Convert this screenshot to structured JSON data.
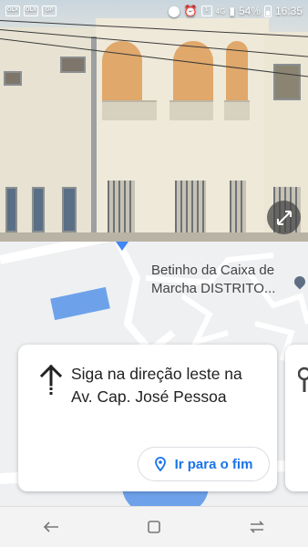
{
  "status_bar": {
    "notifications": [
      "OLX",
      "OLX",
      "GP"
    ],
    "network": "4G",
    "sim_badge": "1",
    "battery": "54%",
    "time": "16:35"
  },
  "street_view": {
    "expand_icon": "expand-arrows-icon"
  },
  "map": {
    "poi_label_line1": "Betinho da Caixa de",
    "poi_label_line2": "Marcha DISTRITO...",
    "water_color": "#6da2ea"
  },
  "direction_card": {
    "instruction": "Siga na direção leste na Av. Cap. José Pessoa",
    "button_label": "Ir para o fim",
    "accent_color": "#1a73e8"
  },
  "nav_bar": {
    "back_icon": "back-arrow-icon",
    "home_icon": "home-square-icon",
    "recents_icon": "recents-icon"
  }
}
